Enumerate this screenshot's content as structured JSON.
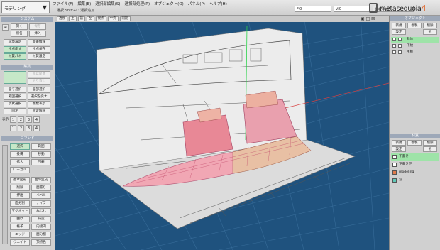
{
  "mode": "モデリング",
  "menu": [
    "ファイル(F)",
    "編集(E)",
    "選択部編集(S)",
    "選択部処理(R)",
    "オブジェクト(O)",
    "パネル(P)",
    "ヘルプ(H)"
  ],
  "status_line": "L: 選択  Shift+L: 選択追加",
  "coord_values": [
    "F:0",
    "V:0",
    "選択平面"
  ],
  "logo_text": "metasequoia",
  "logo_version": "4",
  "left": {
    "system_title": "システム",
    "system_buttons": [
      "開く",
      "保存",
      "別名",
      "挿入",
      "環境設定",
      "文書情報",
      "視点戻す",
      "視点保存",
      "材質パネ",
      "材質設定"
    ],
    "edit_title": "編集",
    "edit_buttons": [
      "元に戻す",
      "やり直し",
      "全て選択",
      "全部選択",
      "範囲選択",
      "選択を戻す",
      "現状選択",
      "複数表示",
      "固定",
      "固定解除"
    ],
    "layer_label": "表示",
    "layer_numbers": [
      "1",
      "2",
      "3",
      "4",
      "1",
      "2",
      "3",
      "4"
    ],
    "command_title": "コマンド",
    "commands": [
      "選択",
      "範囲",
      "投縄",
      "移動",
      "拡大",
      "回転",
      "ローカル",
      "基本図形",
      "面の生成",
      "削除",
      "面張り",
      "押出",
      "ベベル",
      "面分割",
      "ナイフ",
      "マグネット",
      "ねじれ",
      "曲げ",
      "鋳造",
      "格子",
      "内接円",
      "エッジ",
      "面分割",
      "ウエイト",
      "頂点色"
    ]
  },
  "viewport": {
    "toolbar": [
      "透視",
      "上",
      "前",
      "左",
      "視点",
      "中央",
      "同期"
    ],
    "icons": "▣ ◫ ⊞"
  },
  "right": {
    "objects_title": "オブジェクト",
    "objects_buttons": [
      "新規",
      "複製",
      "削除",
      "設定",
      "他"
    ],
    "objects": [
      {
        "name": "船体",
        "selected": true
      },
      {
        "name": "下絵",
        "selected": false
      },
      {
        "name": "甲板",
        "selected": false
      }
    ],
    "materials_title": "材質",
    "materials_buttons": [
      "新規",
      "複製",
      "削除",
      "設定",
      "他"
    ],
    "materials": [
      {
        "name": "下書き",
        "color": "#ffffff",
        "selected": true
      },
      {
        "name": "下書き下",
        "color": "#ffffff",
        "selected": false
      },
      {
        "name": "modeling",
        "color": "#e07a4a",
        "selected": false
      },
      {
        "name": "窓",
        "color": "#5fc9b8",
        "selected": false
      }
    ]
  }
}
